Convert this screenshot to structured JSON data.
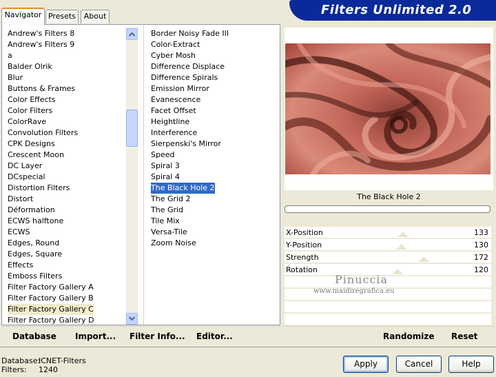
{
  "app": {
    "title": "Filters Unlimited 2.0"
  },
  "tabs": [
    {
      "label": "Navigator",
      "active": true
    },
    {
      "label": "Presets",
      "active": false
    },
    {
      "label": "About",
      "active": false
    }
  ],
  "categories": [
    "Andrew's Filters 8",
    "Andrew's Filters 9",
    "a",
    "Balder Olrik",
    "Blur",
    "Buttons & Frames",
    "Color Effects",
    "Color Filters",
    "ColorRave",
    "Convolution Filters",
    "CPK Designs",
    "Crescent Moon",
    "DC Layer",
    "DCspecial",
    "Distortion Filters",
    "Distort",
    "Déformation",
    "ECWS halftone",
    "ECWS",
    "Edges, Round",
    "Edges, Square",
    "Effects",
    "Emboss Filters",
    "Filter Factory Gallery A",
    "Filter Factory Gallery B",
    "Filter Factory Gallery C",
    "Filter Factory Gallery D"
  ],
  "selected_category": "Filter Factory Gallery C",
  "filters": [
    "Border Noisy Fade III",
    "Color-Extract",
    "Cyber Mosh",
    "Difference Displace",
    "Difference Spirals",
    "Emission Mirror",
    "Evanescence",
    "Facet Offset",
    "Heightline",
    "Interference",
    "Sierpenski's Mirror",
    "Speed",
    "Spiral 3",
    "Spiral 4",
    "The Black Hole 2",
    "The Grid 2",
    "The Grid",
    "Tile Mix",
    "Versa-Tile",
    "Zoom Noise"
  ],
  "selected_filter": "The Black Hole 2",
  "preview_filter_name": "The Black Hole 2",
  "parameters": [
    {
      "label": "X-Position",
      "value": "133",
      "fraction": 0.52
    },
    {
      "label": "Y-Position",
      "value": "130",
      "fraction": 0.51
    },
    {
      "label": "Strength",
      "value": "172",
      "fraction": 0.67
    },
    {
      "label": "Rotation",
      "value": "120",
      "fraction": 0.47
    }
  ],
  "toolbar": {
    "database": "Database",
    "import": "Import...",
    "filter_info": "Filter Info...",
    "editor": "Editor...",
    "randomize": "Randomize",
    "reset": "Reset"
  },
  "status": {
    "database_label": "Database:",
    "database_value": "ICNET-Filters",
    "filters_label": "Filters:",
    "filters_value": "1240"
  },
  "buttons": {
    "apply": "Apply",
    "cancel": "Cancel",
    "help": "Help"
  },
  "watermark": {
    "line1": "Pinuccia",
    "line2": "www.maidiregrafica.eu"
  },
  "colors": {
    "banner": "#0a2a9a",
    "selection": "#316ac5",
    "tab_accent": "#e68b2c"
  }
}
